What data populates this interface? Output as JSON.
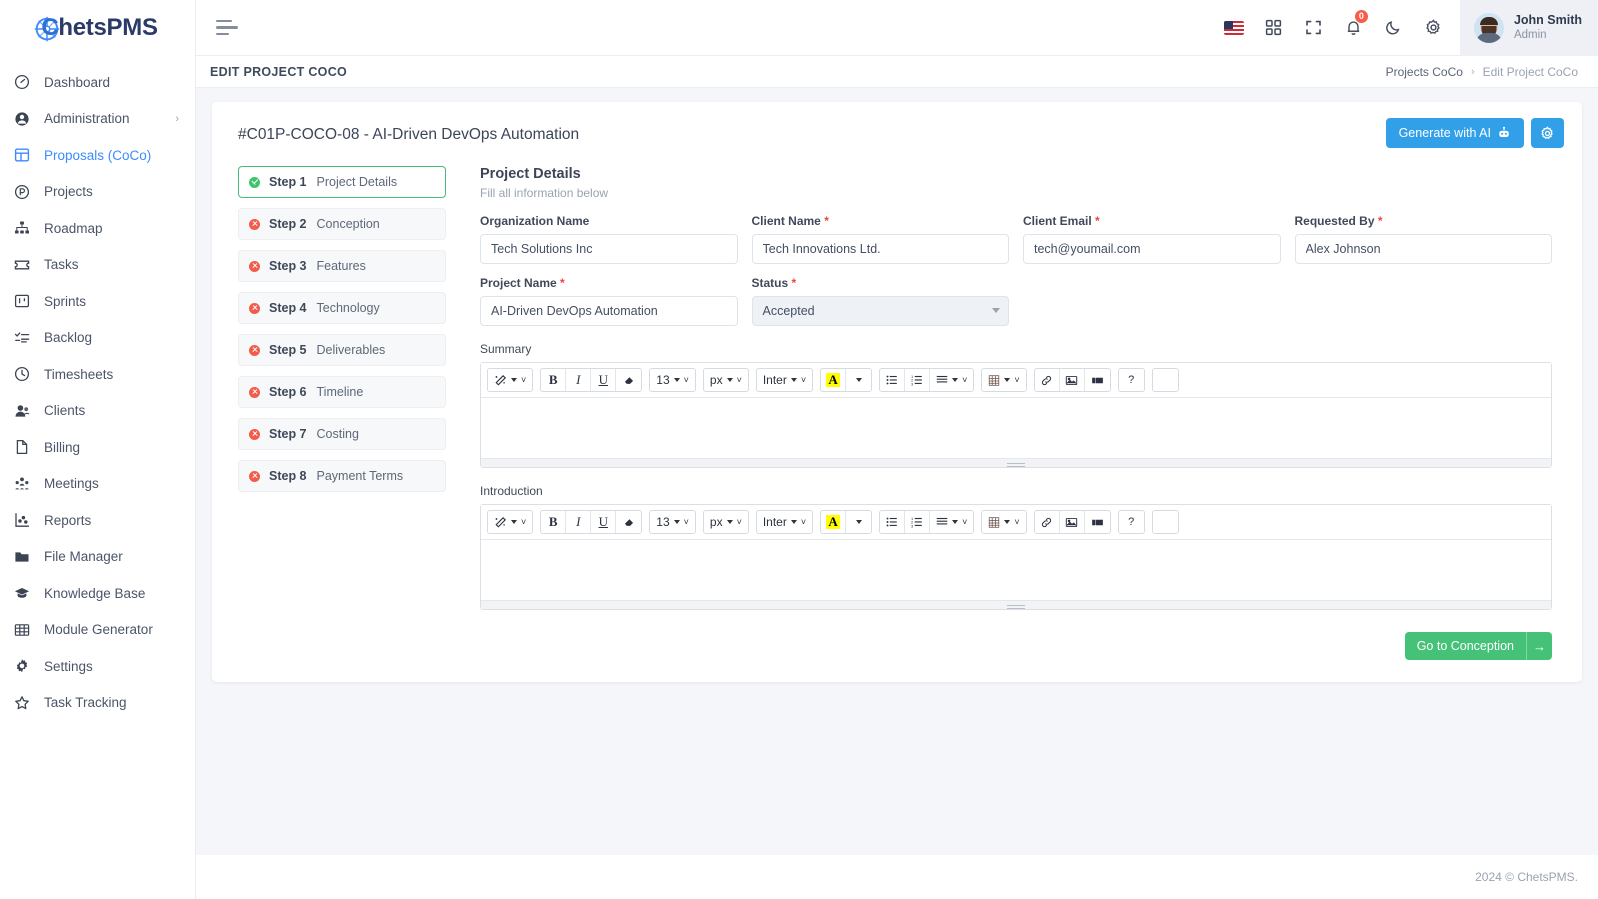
{
  "brand": {
    "name_light": "C",
    "name": "hetsPMS",
    "logo_icon": "compass-logo-icon"
  },
  "sidebar": {
    "items": [
      {
        "label": "Dashboard",
        "icon": "speedometer-icon",
        "active": false,
        "expandable": false
      },
      {
        "label": "Administration",
        "icon": "user-circle-icon",
        "active": false,
        "expandable": true
      },
      {
        "label": "Proposals (CoCo)",
        "icon": "layout-panels-icon",
        "active": true,
        "expandable": false
      },
      {
        "label": "Projects",
        "icon": "circle-p-icon",
        "active": false,
        "expandable": false
      },
      {
        "label": "Roadmap",
        "icon": "sitemap-icon",
        "active": false,
        "expandable": false
      },
      {
        "label": "Tasks",
        "icon": "ticket-icon",
        "active": false,
        "expandable": false
      },
      {
        "label": "Sprints",
        "icon": "kanban-board-icon",
        "active": false,
        "expandable": false
      },
      {
        "label": "Backlog",
        "icon": "list-check-icon",
        "active": false,
        "expandable": false
      },
      {
        "label": "Timesheets",
        "icon": "clock-icon",
        "active": false,
        "expandable": false
      },
      {
        "label": "Clients",
        "icon": "users-icon",
        "active": false,
        "expandable": false
      },
      {
        "label": "Billing",
        "icon": "file-icon",
        "active": false,
        "expandable": false
      },
      {
        "label": "Meetings",
        "icon": "people-group-icon",
        "active": false,
        "expandable": false
      },
      {
        "label": "Reports",
        "icon": "chart-scatter-icon",
        "active": false,
        "expandable": false
      },
      {
        "label": "File Manager",
        "icon": "folder-icon",
        "active": false,
        "expandable": false
      },
      {
        "label": "Knowledge Base",
        "icon": "graduation-cap-icon",
        "active": false,
        "expandable": false
      },
      {
        "label": "Module Generator",
        "icon": "grid-table-icon",
        "active": false,
        "expandable": false
      },
      {
        "label": "Settings",
        "icon": "gear-icon",
        "active": false,
        "expandable": false
      },
      {
        "label": "Task Tracking",
        "icon": "star-icon",
        "active": false,
        "expandable": false
      }
    ]
  },
  "topbar": {
    "menu_toggle_icon": "hamburger-icon",
    "language_flag": "us-flag-icon",
    "apps_icon": "grid-apps-icon",
    "fullscreen_icon": "fullscreen-icon",
    "notifications_icon": "bell-icon",
    "notifications_count": "0",
    "dark_mode_icon": "moon-icon",
    "settings_icon": "gear-icon",
    "user_name": "John Smith",
    "user_role": "Admin"
  },
  "pagehead": {
    "title": "EDIT PROJECT COCO",
    "breadcrumb_parent": "Projects CoCo",
    "breadcrumb_sep": "›",
    "breadcrumb_current": "Edit Project CoCo"
  },
  "card": {
    "title": "#C01P-COCO-08 - AI-Driven DevOps Automation",
    "generate_label": "Generate with AI",
    "generate_icon": "robot-icon",
    "settings_icon": "gear-icon"
  },
  "steps": [
    {
      "num": "Step 1",
      "title": "Project Details",
      "state": "ok"
    },
    {
      "num": "Step 2",
      "title": "Conception",
      "state": "err"
    },
    {
      "num": "Step 3",
      "title": "Features",
      "state": "err"
    },
    {
      "num": "Step 4",
      "title": "Technology",
      "state": "err"
    },
    {
      "num": "Step 5",
      "title": "Deliverables",
      "state": "err"
    },
    {
      "num": "Step 6",
      "title": "Timeline",
      "state": "err"
    },
    {
      "num": "Step 7",
      "title": "Costing",
      "state": "err"
    },
    {
      "num": "Step 8",
      "title": "Payment Terms",
      "state": "err"
    }
  ],
  "form": {
    "heading": "Project Details",
    "subheading": "Fill all information below",
    "required_mark": "*",
    "fields": [
      {
        "label": "Organization Name",
        "required": false,
        "value": "Tech Solutions Inc",
        "type": "text"
      },
      {
        "label": "Client Name",
        "required": true,
        "value": "Tech Innovations Ltd.",
        "type": "text"
      },
      {
        "label": "Client Email",
        "required": true,
        "value": "tech@youmail.com",
        "type": "text"
      },
      {
        "label": "Requested By",
        "required": true,
        "value": "Alex Johnson",
        "type": "text"
      },
      {
        "label": "Project Name",
        "required": true,
        "value": "AI-Driven DevOps Automation",
        "type": "text"
      },
      {
        "label": "Status",
        "required": true,
        "value": "Accepted",
        "type": "select"
      }
    ],
    "editors": [
      {
        "label": "Summary",
        "content": ""
      },
      {
        "label": "Introduction",
        "content": ""
      }
    ],
    "next_label": "Go to Conception",
    "next_icon": "arrow-right-icon"
  },
  "editor_toolbar": {
    "groups": [
      {
        "buttons": [
          {
            "icon": "magic-wand-icon",
            "label": "",
            "caret": true,
            "chevron": true
          }
        ]
      },
      {
        "buttons": [
          {
            "icon": "bold-icon",
            "label": "B",
            "caret": false,
            "chevron": false
          },
          {
            "icon": "italic-icon",
            "label": "I",
            "caret": false,
            "chevron": false
          },
          {
            "icon": "underline-icon",
            "label": "U",
            "caret": false,
            "chevron": false
          },
          {
            "icon": "eraser-icon",
            "label": "",
            "caret": false,
            "chevron": false
          }
        ]
      },
      {
        "buttons": [
          {
            "icon": "font-size-icon",
            "label": "13",
            "caret": true,
            "chevron": true
          }
        ]
      },
      {
        "buttons": [
          {
            "icon": "font-unit-icon",
            "label": "px",
            "caret": true,
            "chevron": true
          }
        ]
      },
      {
        "buttons": [
          {
            "icon": "font-family-icon",
            "label": "Inter",
            "caret": true,
            "chevron": true
          }
        ]
      },
      {
        "buttons": [
          {
            "icon": "text-highlight-icon",
            "label": "A",
            "caret": false,
            "chevron": false
          },
          {
            "icon": "color-dropdown-icon",
            "label": "",
            "caret": true,
            "chevron": false
          }
        ]
      },
      {
        "buttons": [
          {
            "icon": "bullet-list-icon",
            "label": "",
            "caret": false,
            "chevron": false
          },
          {
            "icon": "numbered-list-icon",
            "label": "",
            "caret": false,
            "chevron": false
          },
          {
            "icon": "align-icon",
            "label": "",
            "caret": true,
            "chevron": true
          }
        ]
      },
      {
        "buttons": [
          {
            "icon": "table-icon",
            "label": "",
            "caret": true,
            "chevron": true
          }
        ]
      },
      {
        "buttons": [
          {
            "icon": "link-icon",
            "label": "",
            "caret": false,
            "chevron": false
          },
          {
            "icon": "image-icon",
            "label": "",
            "caret": false,
            "chevron": false
          },
          {
            "icon": "video-icon",
            "label": "",
            "caret": false,
            "chevron": false
          }
        ]
      },
      {
        "buttons": [
          {
            "icon": "code-view-icon",
            "label": "</>",
            "caret": false,
            "chevron": false
          }
        ]
      },
      {
        "buttons": [
          {
            "icon": "help-icon",
            "label": "?",
            "caret": false,
            "chevron": false
          }
        ]
      }
    ]
  },
  "footer": {
    "text": "2024 © ChetsPMS."
  },
  "colors": {
    "accent_blue": "#31a0e8",
    "active_nav": "#3d8bfd",
    "success_green": "#3ec46d",
    "error_red": "#f15d4a",
    "next_green": "#45c178",
    "badge_red": "#fa5c4b"
  }
}
